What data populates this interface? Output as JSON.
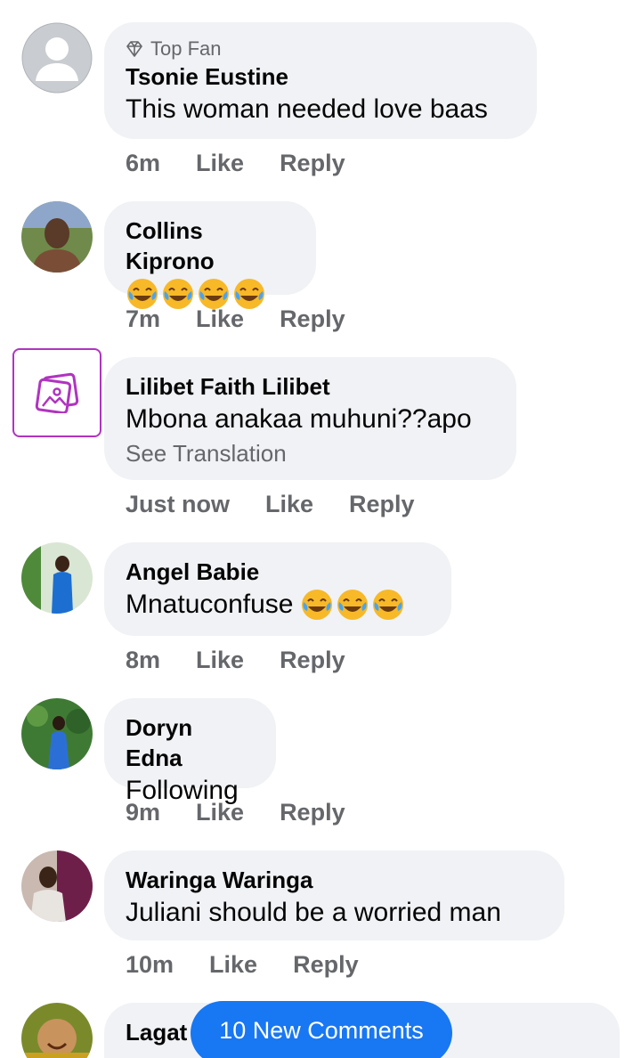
{
  "comments": [
    {
      "badge": "Top Fan",
      "name": "Tsonie Eustine",
      "text": "This woman needed love baas",
      "time": "6m",
      "like": "Like",
      "reply": "Reply"
    },
    {
      "name": "Collins Kiprono",
      "text": "",
      "emoji_count": 4,
      "time": "7m",
      "like": "Like",
      "reply": "Reply"
    },
    {
      "name": "Lilibet Faith Lilibet",
      "text": "Mbona anakaa muhuni??apo",
      "translate": "See Translation",
      "time": "Just now",
      "like": "Like",
      "reply": "Reply"
    },
    {
      "name": "Angel Babie",
      "text": "Mnatuconfuse",
      "emoji_count": 3,
      "time": "8m",
      "like": "Like",
      "reply": "Reply"
    },
    {
      "name": "Doryn Edna",
      "text": "Following",
      "time": "9m",
      "like": "Like",
      "reply": "Reply"
    },
    {
      "name": "Waringa Waringa",
      "text": "Juliani should be a worried man",
      "time": "10m",
      "like": "Like",
      "reply": "Reply"
    },
    {
      "name": "Lagat"
    }
  ],
  "new_comments_button": "10 New Comments",
  "icons": {
    "badge": "diamond-icon",
    "emoji": "face-with-tears-of-joy-icon",
    "placeholder": "image-placeholder-icon"
  },
  "colors": {
    "bubble": "#f0f2f5",
    "accent": "#1877f2",
    "secondary_text": "#65676b",
    "placeholder_border": "#b034c0"
  }
}
